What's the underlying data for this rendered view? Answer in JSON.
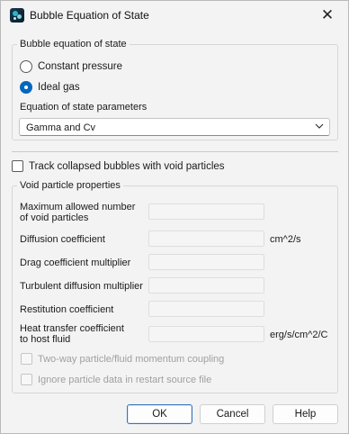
{
  "window": {
    "title": "Bubble Equation of State",
    "close_glyph": "✕"
  },
  "bubble_eos": {
    "group_label": "Bubble equation of state",
    "options": [
      {
        "label": "Constant pressure",
        "selected": false
      },
      {
        "label": "Ideal gas",
        "selected": true
      }
    ],
    "params_label": "Equation of state parameters",
    "params_value": "Gamma and Cv"
  },
  "track_collapsed": {
    "label": "Track collapsed bubbles with void particles",
    "checked": false
  },
  "void_props": {
    "group_label": "Void particle properties",
    "fields": [
      {
        "label_line1": "Maximum allowed number",
        "label_line2": "of void particles",
        "value": "",
        "unit": ""
      },
      {
        "label_line1": "Diffusion coefficient",
        "label_line2": "",
        "value": "",
        "unit": "cm^2/s"
      },
      {
        "label_line1": "Drag coefficient multiplier",
        "label_line2": "",
        "value": "",
        "unit": ""
      },
      {
        "label_line1": "Turbulent diffusion multiplier",
        "label_line2": "",
        "value": "",
        "unit": ""
      },
      {
        "label_line1": "Restitution coefficient",
        "label_line2": "",
        "value": "",
        "unit": ""
      },
      {
        "label_line1": "Heat transfer coefficient",
        "label_line2": "to host fluid",
        "value": "",
        "unit": "erg/s/cm^2/C"
      }
    ],
    "two_way_label": "Two-way particle/fluid momentum coupling",
    "ignore_label": "Ignore particle data in restart source file"
  },
  "buttons": {
    "ok": "OK",
    "cancel": "Cancel",
    "help": "Help"
  },
  "colors": {
    "accent": "#0067c0",
    "background": "#f3f3f3"
  }
}
